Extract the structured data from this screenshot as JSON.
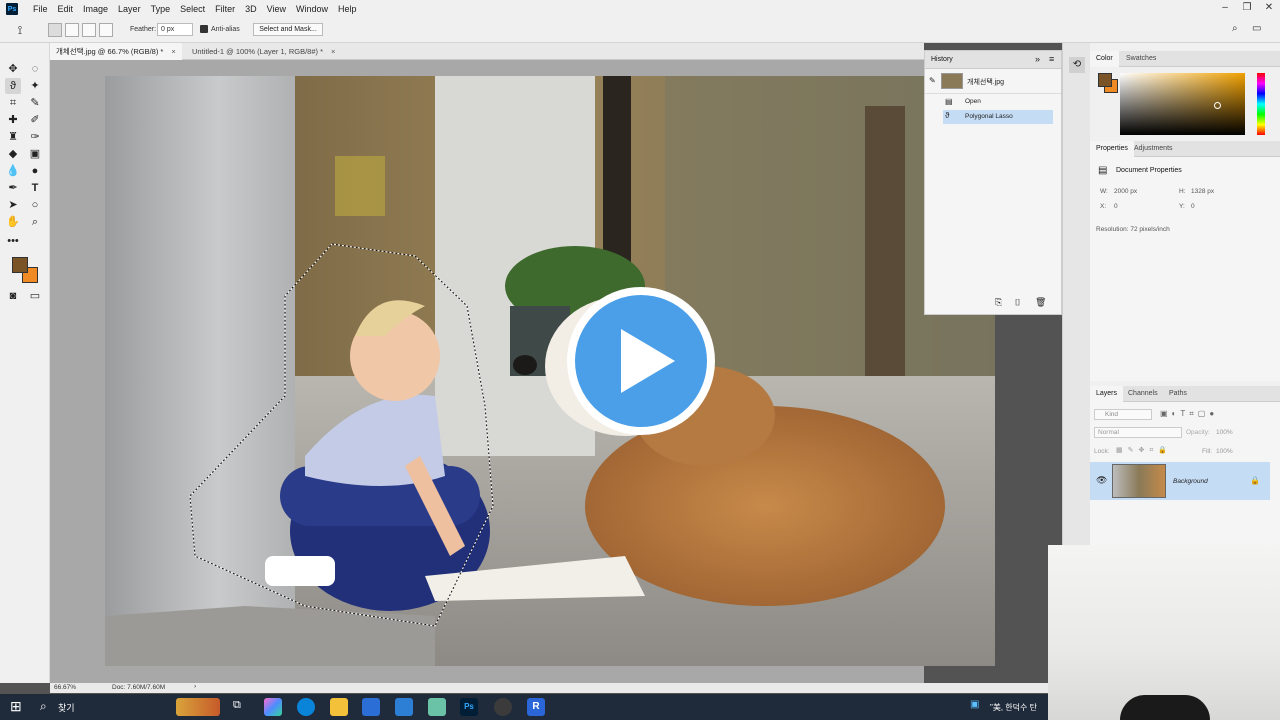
{
  "app": {
    "logo": "Ps",
    "menu": [
      "File",
      "Edit",
      "Image",
      "Layer",
      "Type",
      "Select",
      "Filter",
      "3D",
      "View",
      "Window",
      "Help"
    ]
  },
  "options": {
    "feather_label": "Feather:",
    "feather_value": "0 px",
    "antialias_label": "Anti-alias",
    "select_mask_label": "Select and Mask..."
  },
  "tabs": [
    {
      "label": "개체선택.jpg @ 66.7% (RGB/8) *",
      "active": true
    },
    {
      "label": "Untitled-1 @ 100% (Layer 1, RGB/8#) *",
      "active": false
    }
  ],
  "tab_close": "×",
  "status": {
    "zoom": "66.67%",
    "doc": "Doc: 7.60M/7.60M"
  },
  "history": {
    "title": "History",
    "snapshot_name": "개체선택.jpg",
    "items": [
      {
        "label": "Open",
        "selected": false
      },
      {
        "label": "Polygonal Lasso",
        "selected": true
      }
    ]
  },
  "color_panel": {
    "tabs": [
      "Color",
      "Swatches"
    ],
    "foreground": "#7a5426",
    "background": "#f08a24"
  },
  "properties": {
    "tabs": [
      "Properties",
      "Adjustments"
    ],
    "title": "Document Properties",
    "w_label": "W:",
    "w_value": "2000 px",
    "h_label": "H:",
    "h_value": "1328 px",
    "x_label": "X:",
    "x_value": "0",
    "y_label": "Y:",
    "y_value": "0",
    "resolution": "Resolution: 72 pixels/inch"
  },
  "layers": {
    "tabs": [
      "Layers",
      "Channels",
      "Paths"
    ],
    "kind_label": "Kind",
    "blend_mode": "Normal",
    "opacity_label": "Opacity:",
    "opacity_value": "100%",
    "lock_label": "Lock:",
    "fill_label": "Fill:",
    "fill_value": "100%",
    "layer_name": "Background"
  },
  "taskbar": {
    "search_text": "찾기",
    "tray_text": "\"美, 한덕수 탄"
  },
  "colors": {
    "accent": "#31a8ff",
    "play_button": "#4a9fe8",
    "selected_row": "#c5dcf5"
  }
}
